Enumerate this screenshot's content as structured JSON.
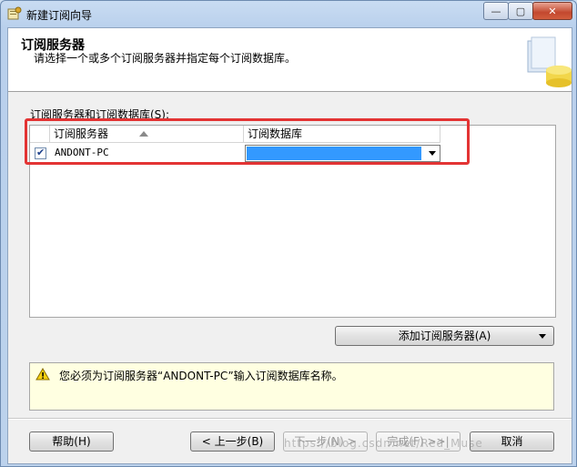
{
  "window": {
    "title": "新建订阅向导",
    "minimize_glyph": "—",
    "maximize_glyph": "▢",
    "close_glyph": "✕"
  },
  "header": {
    "title": "订阅服务器",
    "subtitle": "请选择一个或多个订阅服务器并指定每个订阅数据库。"
  },
  "grid": {
    "label": "订阅服务器和订阅数据库(S):",
    "columns": [
      "订阅服务器",
      "订阅数据库"
    ],
    "rows": [
      {
        "checked": true,
        "server": "ANDONT-PC",
        "database": ""
      }
    ]
  },
  "add_subscriber_button": "添加订阅服务器(A)",
  "message": {
    "icon": "warning-icon",
    "text": "您必须为订阅服务器“ANDONT-PC”输入订阅数据库名称。"
  },
  "buttons": {
    "help": "帮助(H)",
    "prev": "< 上一步(B)",
    "next": "下一步(N) >",
    "finish": "完成(F) >>|",
    "cancel": "取消"
  },
  "watermark": "https://blog.csdn.net/Red_Muse",
  "colors": {
    "selection": "#3399ff",
    "highlight_border": "#e33434",
    "message_bg": "#ffffe1"
  }
}
